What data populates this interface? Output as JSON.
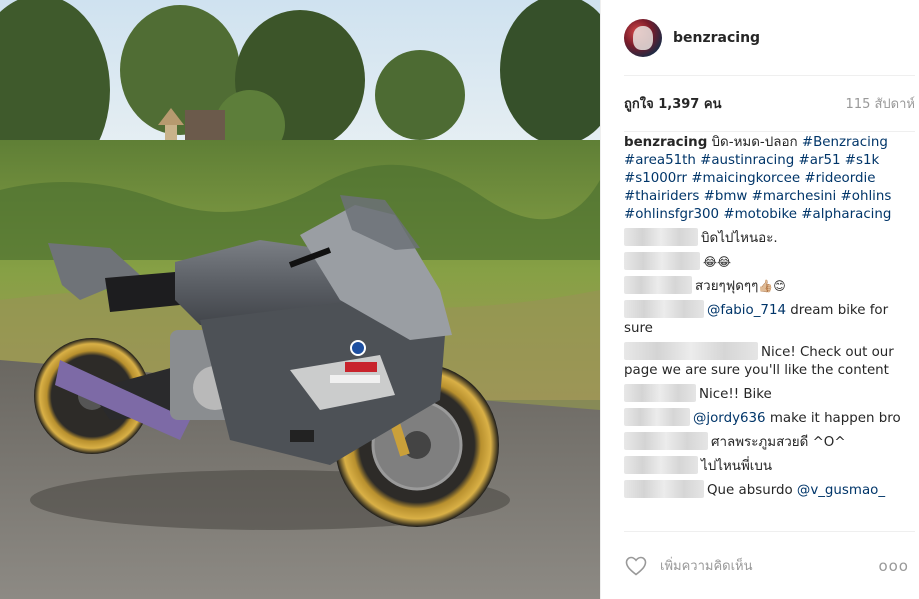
{
  "post": {
    "author": "benzracing",
    "likes_text": "ถูกใจ 1,397 คน",
    "age_text": "115 สัปดาห์",
    "caption": {
      "username": "benzracing",
      "text": "บิด-หมด-ปลอก",
      "hashtags": [
        "#Benzracing",
        "#area51th",
        "#austinracing",
        "#ar51",
        "#s1k",
        "#s1000rr",
        "#maicingkorcee",
        "#rideordie",
        "#thairiders",
        "#bmw",
        "#marchesini",
        "#ohlins",
        "#ohlinsfgr300",
        "#motobike",
        "#alpharacing"
      ]
    },
    "comments": [
      {
        "text": "บิดไปไหนอะ."
      },
      {
        "text": "",
        "emoji": "😂😂"
      },
      {
        "text": "สวยๆฟุดๆๆ",
        "emoji": "👍🏼😊"
      },
      {
        "mention": "@fabio_714",
        "text": " dream bike for sure"
      },
      {
        "text": "Nice! Check out our page we are sure you'll like the content"
      },
      {
        "text": "Nice!! Bike"
      },
      {
        "mention": "@jordy636",
        "text": " make it happen bro"
      },
      {
        "text": "ศาลพระภูมสวยดี ^O^"
      },
      {
        "text": "ไปไหนพี่เบน"
      },
      {
        "text": "Que absurdo ",
        "mention_after": "@v_gusmao_"
      }
    ],
    "add_comment_placeholder": "เพิ่มความคิดเห็น",
    "more_label": "ooo",
    "icons": {
      "like": "heart-icon",
      "more": "more-options-icon"
    },
    "colors": {
      "link": "#003569",
      "muted": "#999999",
      "divider": "#efefef"
    }
  }
}
